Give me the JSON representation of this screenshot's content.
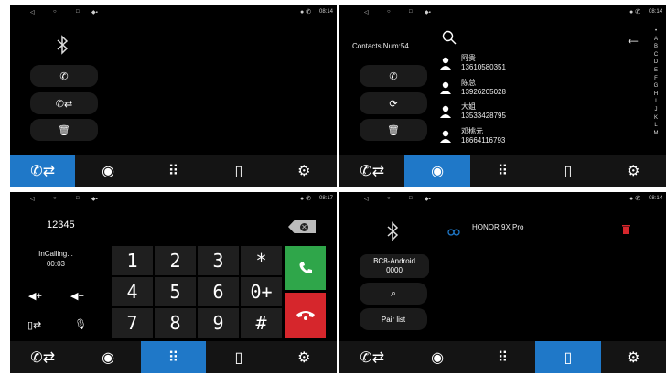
{
  "status": {
    "time_p1": "08:14",
    "time_p2": "08:14",
    "time_p3": "08:17",
    "time_p4": "08:14"
  },
  "nav": {
    "tabs": [
      "call-transfer",
      "contacts",
      "dialpad",
      "bluetooth-device",
      "settings"
    ]
  },
  "panel1": {
    "buttons": [
      "call",
      "call-transfer",
      "delete"
    ]
  },
  "panel2": {
    "contacts_num": "Contacts Num:54",
    "alphabet": [
      "•",
      "A",
      "B",
      "C",
      "D",
      "E",
      "F",
      "G",
      "H",
      "I",
      "J",
      "K",
      "L",
      "M"
    ],
    "contacts": [
      {
        "name": "阿贵",
        "number": "13610580351"
      },
      {
        "name": "陈总",
        "number": "13926205028"
      },
      {
        "name": "大姐",
        "number": "13533428795"
      },
      {
        "name": "邓桃元",
        "number": "18664116793"
      }
    ]
  },
  "panel3": {
    "dialed_number": "12345",
    "call_status": "InCalling...",
    "call_time": "00:03",
    "keys": [
      "1",
      "2",
      "3",
      "*",
      "4",
      "5",
      "6",
      "0+",
      "7",
      "8",
      "9",
      "#"
    ]
  },
  "panel4": {
    "device_name": "HONOR 9X Pro",
    "local_name": "BC8-Android",
    "pin": "0000",
    "pair_list_label": "Pair list"
  },
  "colors": {
    "active_tab": "#1f78c8",
    "green": "#2fa64a",
    "red": "#d6262c"
  }
}
